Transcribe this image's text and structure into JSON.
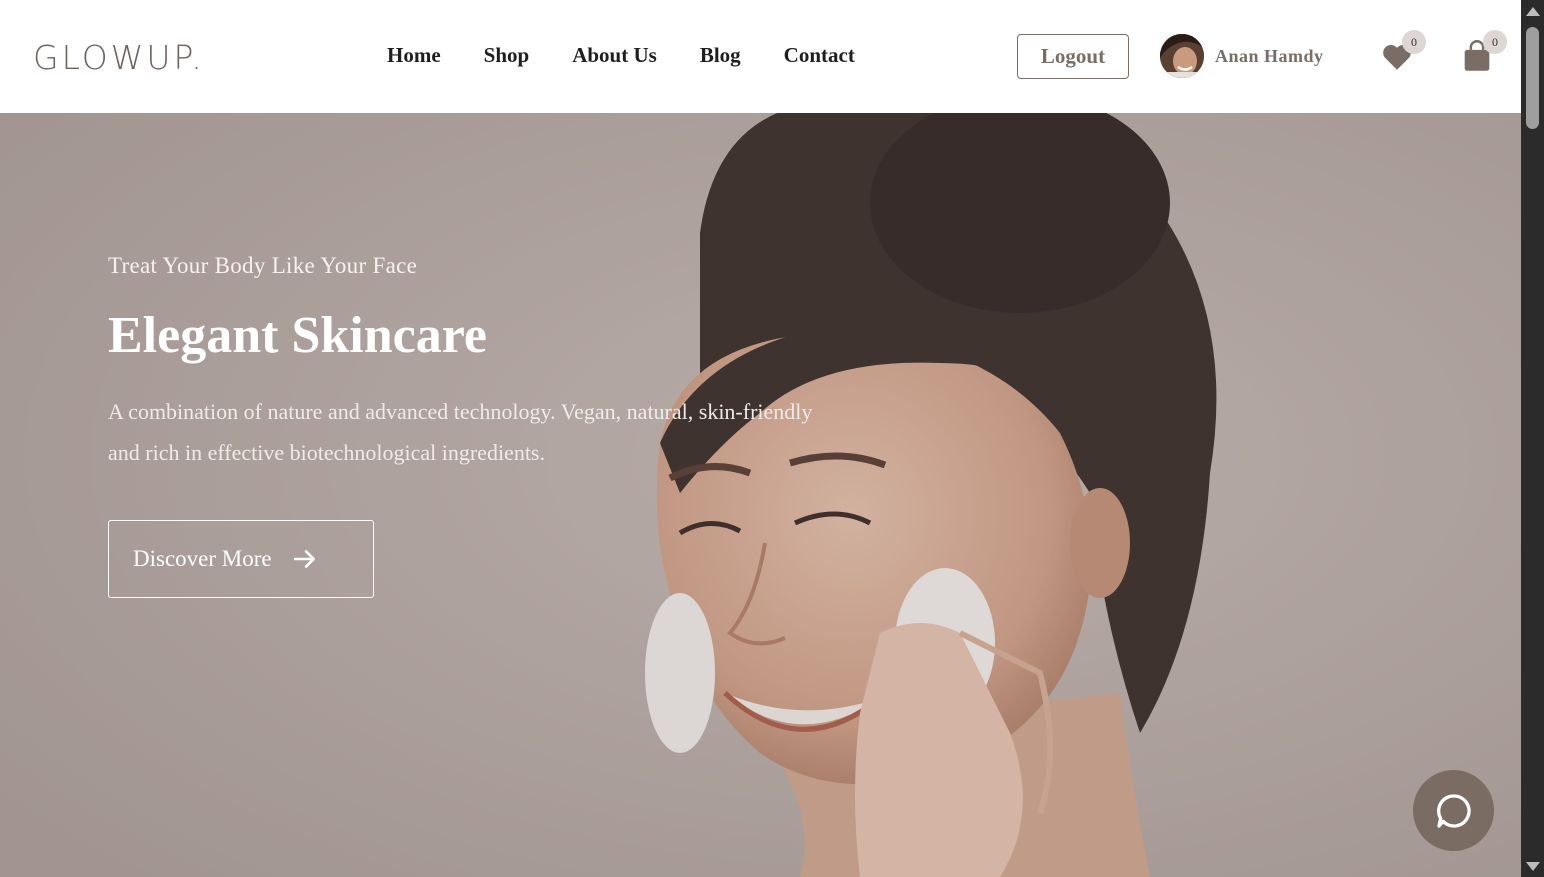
{
  "brand": {
    "logo": "GLOWUP."
  },
  "nav": {
    "items": [
      {
        "label": "Home"
      },
      {
        "label": "Shop"
      },
      {
        "label": "About Us"
      },
      {
        "label": "Blog"
      },
      {
        "label": "Contact"
      }
    ]
  },
  "account": {
    "logout_label": "Logout",
    "username": "Anan Hamdy"
  },
  "wishlist": {
    "count": "0",
    "icon": "heart-icon"
  },
  "cart": {
    "count": "0",
    "icon": "shopping-bag-icon"
  },
  "hero": {
    "subtitle": "Treat Your Body Like Your Face",
    "title": "Elegant Skincare",
    "description": "A combination of nature and advanced technology. Vegan, natural, skin-friendly and rich in effective biotechnological ingredients.",
    "cta_label": "Discover More",
    "cta_icon": "arrow-right-icon"
  },
  "chat": {
    "icon": "chat-bubble-icon"
  },
  "colors": {
    "accent": "#7a6d66",
    "hero_bg": "#b9aeaa",
    "chat_bg": "#7a6b63"
  }
}
